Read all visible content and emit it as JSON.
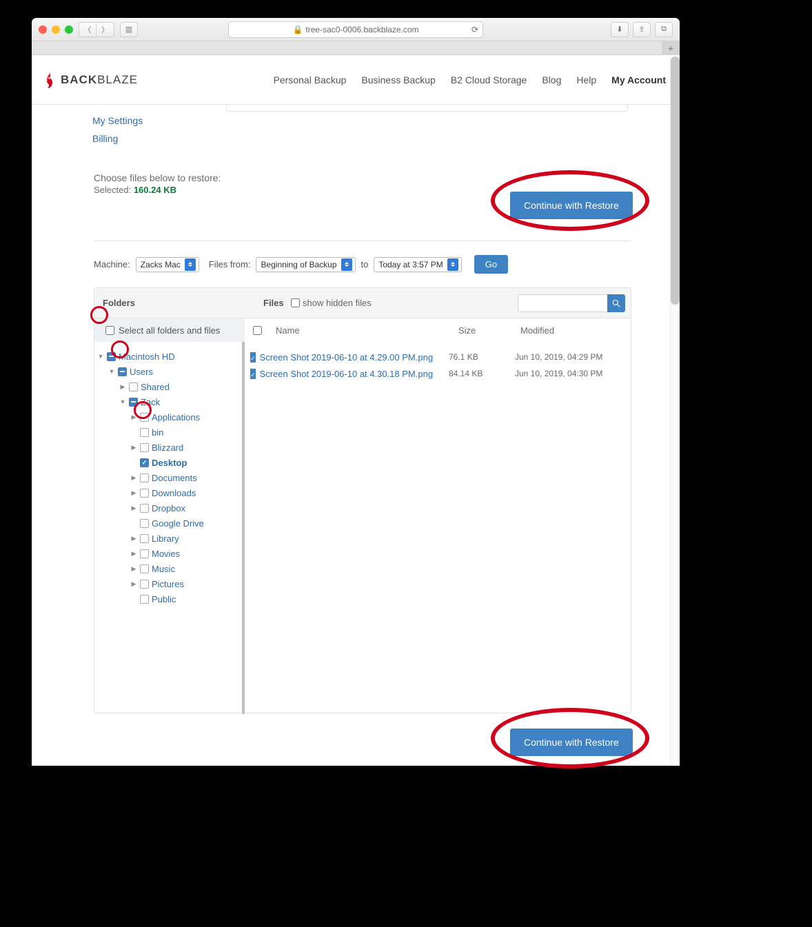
{
  "browser_chrome": {
    "url": "tree-sac0-0006.backblaze.com"
  },
  "brand": {
    "name_bold": "BACK",
    "name_rest": "BLAZE"
  },
  "nav": {
    "personal": "Personal Backup",
    "business": "Business Backup",
    "b2": "B2 Cloud Storage",
    "blog": "Blog",
    "help": "Help",
    "account": "My Account"
  },
  "sidebar": {
    "settings": "My Settings",
    "billing": "Billing"
  },
  "selection": {
    "heading": "Choose files below to restore:",
    "selected_label": "Selected:",
    "selected_value": "160.24 KB"
  },
  "buttons": {
    "continue": "Continue with Restore",
    "go": "Go"
  },
  "filters": {
    "machine_label": "Machine:",
    "machine_value": "Zacks Mac",
    "files_from_label": "Files from:",
    "files_from_value": "Beginning of Backup",
    "to_label": "to",
    "to_value": "Today at 3:57 PM"
  },
  "columns": {
    "folders": "Folders",
    "files": "Files",
    "hidden": "show hidden files",
    "select_all": "Select all folders and files",
    "name": "Name",
    "size": "Size",
    "modified": "Modified"
  },
  "tree": {
    "root": "Macintosh HD",
    "users": "Users",
    "shared": "Shared",
    "zack": "Zack",
    "apps": "Applications",
    "bin": "bin",
    "blizzard": "Blizzard",
    "desktop": "Desktop",
    "documents": "Documents",
    "downloads": "Downloads",
    "dropbox": "Dropbox",
    "gdrive": "Google Drive",
    "library": "Library",
    "movies": "Movies",
    "music": "Music",
    "pictures": "Pictures",
    "public": "Public"
  },
  "files": [
    {
      "name": "Screen Shot 2019-06-10 at 4.29.00 PM.png",
      "size": "76.1 KB",
      "modified": "Jun 10, 2019, 04:29 PM",
      "checked": true
    },
    {
      "name": "Screen Shot 2019-06-10 at 4.30.18 PM.png",
      "size": "84.14 KB",
      "modified": "Jun 10, 2019, 04:30 PM",
      "checked": true
    }
  ]
}
